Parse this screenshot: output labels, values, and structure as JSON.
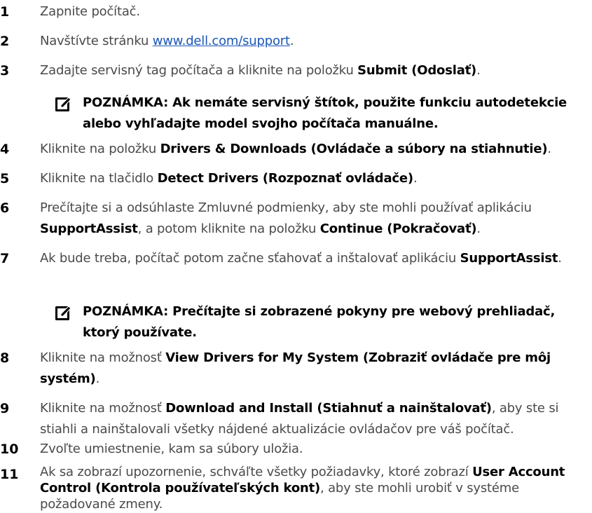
{
  "steps": [
    {
      "num": "1",
      "parts": [
        {
          "t": "Zapnite počítač."
        }
      ]
    },
    {
      "num": "2",
      "parts": [
        {
          "t": "Navštívte stránku "
        },
        {
          "t": "www.dell.com/support",
          "link": true
        },
        {
          "t": "."
        }
      ]
    },
    {
      "num": "3",
      "parts": [
        {
          "t": "Zadajte servisný tag počítača a kliknite na položku "
        },
        {
          "t": "Submit (Odoslať)",
          "bold": true
        },
        {
          "t": "."
        }
      ]
    },
    {
      "num": "4",
      "parts": [
        {
          "t": "Kliknite na položku "
        },
        {
          "t": "Drivers & Downloads (Ovládače a súbory na stiahnutie)",
          "bold": true
        },
        {
          "t": "."
        }
      ]
    },
    {
      "num": "5",
      "parts": [
        {
          "t": "Kliknite na tlačidlo "
        },
        {
          "t": "Detect Drivers (Rozpoznať ovládače)",
          "bold": true
        },
        {
          "t": "."
        }
      ]
    },
    {
      "num": "6",
      "parts": [
        {
          "t": "Prečítajte si a odsúhlaste Zmluvné podmienky, aby ste mohli používať aplikáciu "
        },
        {
          "t": "SupportAssist",
          "bold": true
        },
        {
          "t": ", a potom kliknite na položku "
        },
        {
          "t": "Continue (Pokračovať)",
          "bold": true
        },
        {
          "t": "."
        }
      ]
    },
    {
      "num": "7",
      "parts": [
        {
          "t": "Ak bude treba, počítač potom začne sťahovať a inštalovať aplikáciu "
        },
        {
          "t": "SupportAssist",
          "bold": true
        },
        {
          "t": "."
        }
      ]
    },
    {
      "num": "8",
      "parts": [
        {
          "t": "Kliknite na možnosť "
        },
        {
          "t": "View Drivers for My System (Zobraziť ovládače pre môj systém)",
          "bold": true
        },
        {
          "t": "."
        }
      ]
    },
    {
      "num": "9",
      "parts": [
        {
          "t": "Kliknite na možnosť "
        },
        {
          "t": "Download and Install (Stiahnuť a nainštalovať)",
          "bold": true
        },
        {
          "t": ", aby ste si stiahli a nainštalovali všetky nájdené aktualizácie ovládačov pre váš počítač."
        }
      ]
    },
    {
      "num": "10",
      "parts": [
        {
          "t": "Zvoľte umiestnenie, kam sa súbory uložia."
        }
      ]
    },
    {
      "num": "11",
      "parts": [
        {
          "t": "Ak sa zobrazí upozornenie, schváľte všetky požiadavky, ktoré zobrazí "
        },
        {
          "t": "User Account Control (Kontrola používateľských kont)",
          "bold": true
        },
        {
          "t": ", aby ste mohli urobiť v systéme požadované zmeny."
        }
      ]
    }
  ],
  "notes": [
    {
      "text": "POZNÁMKA: Ak nemáte servisný štítok, použite funkciu autodetekcie alebo vyhľadajte model svojho počítača manuálne.",
      "icon": "note-pencil-icon"
    },
    {
      "text": "POZNÁMKA: Prečítajte si zobrazené pokyny pre webový prehliadač, ktorý používate.",
      "icon": "note-pencil-icon"
    }
  ]
}
